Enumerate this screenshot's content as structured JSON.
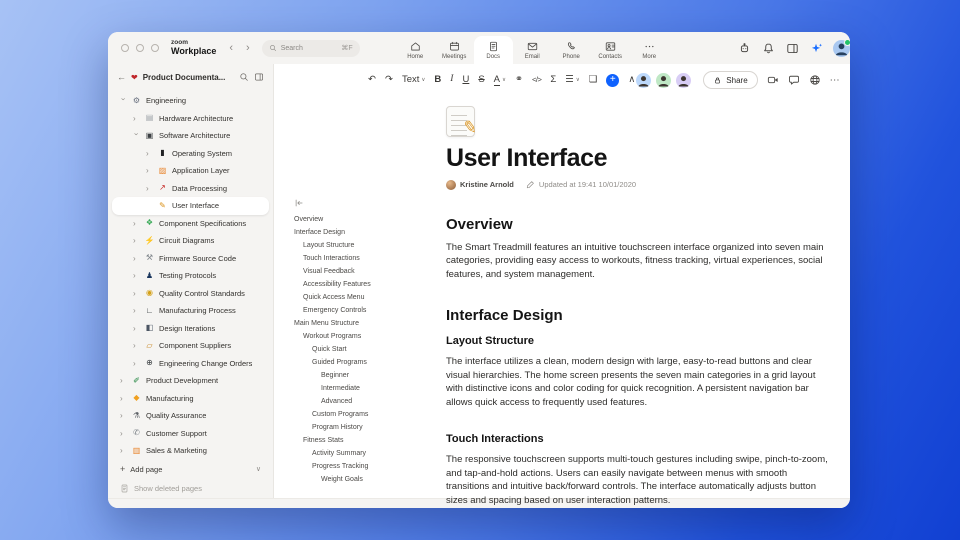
{
  "chrome": {
    "logo": {
      "top": "zoom",
      "bottom": "Workplace"
    },
    "nav": {
      "back": "‹",
      "forward": "›"
    },
    "search": {
      "placeholder": "Search",
      "shortcut": "⌘F"
    },
    "tabs": [
      {
        "id": "home",
        "label": "Home",
        "icon": "home-icon",
        "active": false
      },
      {
        "id": "meetings",
        "label": "Meetings",
        "icon": "meetings-icon",
        "active": false
      },
      {
        "id": "docs",
        "label": "Docs",
        "icon": "docs-icon",
        "active": true
      },
      {
        "id": "email",
        "label": "Email",
        "icon": "email-icon",
        "active": false
      },
      {
        "id": "phone",
        "label": "Phone",
        "icon": "phone-icon",
        "active": false
      },
      {
        "id": "contacts",
        "label": "Contacts",
        "icon": "contacts-icon",
        "active": false
      },
      {
        "id": "more",
        "label": "More",
        "icon": "more-icon",
        "active": false
      }
    ],
    "right_icons": [
      {
        "name": "assistant-icon"
      },
      {
        "name": "notifications-bell-icon"
      },
      {
        "name": "side-panel-icon"
      },
      {
        "name": "ai-companion-sparkle-icon"
      }
    ],
    "status_color": "#23c26b"
  },
  "sidebar": {
    "title": "Product Documenta...",
    "items": [
      {
        "label": "Engineering",
        "level": 0,
        "state": "expanded",
        "icon": "gear-emoji-icon",
        "glyph": "⚙",
        "color": "#6b7280"
      },
      {
        "label": "Hardware Architecture",
        "level": 1,
        "state": "collapsed",
        "icon": "chip-emoji-icon",
        "glyph": "▤",
        "color": "#9aa0a6"
      },
      {
        "label": "Software Architecture",
        "level": 1,
        "state": "expanded",
        "icon": "computer-emoji-icon",
        "glyph": "▣",
        "color": "#3c4043"
      },
      {
        "label": "Operating System",
        "level": 2,
        "state": "collapsed",
        "icon": "mobile-phone-emoji-icon",
        "glyph": "▮",
        "color": "#202124"
      },
      {
        "label": "Application Layer",
        "level": 2,
        "state": "collapsed",
        "icon": "framed-picture-emoji-icon",
        "glyph": "▨",
        "color": "#e8842c"
      },
      {
        "label": "Data Processing",
        "level": 2,
        "state": "collapsed",
        "icon": "chart-increasing-emoji-icon",
        "glyph": "↗",
        "color": "#c5221f"
      },
      {
        "label": "User Interface",
        "level": 2,
        "state": "none",
        "selected": true,
        "icon": "memo-emoji-icon",
        "glyph": "✎",
        "color": "#d98f16"
      },
      {
        "label": "Component Specifications",
        "level": 1,
        "state": "collapsed",
        "icon": "puzzle-piece-emoji-icon",
        "glyph": "❖",
        "color": "#34a853"
      },
      {
        "label": "Circuit Diagrams",
        "level": 1,
        "state": "collapsed",
        "icon": "electric-plug-emoji-icon",
        "glyph": "⚡",
        "color": "#3c4043"
      },
      {
        "label": "Firmware Source Code",
        "level": 1,
        "state": "collapsed",
        "icon": "wrench-emoji-icon",
        "glyph": "⚒",
        "color": "#80868b"
      },
      {
        "label": "Testing Protocols",
        "level": 1,
        "state": "collapsed",
        "icon": "officer-emoji-icon",
        "glyph": "♟",
        "color": "#1a365d"
      },
      {
        "label": "Quality Control Standards",
        "level": 1,
        "state": "collapsed",
        "icon": "traffic-light-emoji-icon",
        "glyph": "◉",
        "color": "#d4a017"
      },
      {
        "label": "Manufacturing Process",
        "level": 1,
        "state": "collapsed",
        "icon": "mechanical-arm-emoji-icon",
        "glyph": "∟",
        "color": "#3c4043"
      },
      {
        "label": "Design Iterations",
        "level": 1,
        "state": "collapsed",
        "icon": "camera-emoji-icon",
        "glyph": "◧",
        "color": "#4b5563"
      },
      {
        "label": "Component Suppliers",
        "level": 1,
        "state": "collapsed",
        "icon": "delivery-truck-emoji-icon",
        "glyph": "▱",
        "color": "#c47f17"
      },
      {
        "label": "Engineering Change Orders",
        "level": 1,
        "state": "collapsed",
        "icon": "globe-emoji-icon",
        "glyph": "⊕",
        "color": "#3c4043"
      },
      {
        "label": "Product Development",
        "level": 0,
        "state": "collapsed",
        "icon": "pen-emoji-icon",
        "glyph": "✐",
        "color": "#188038"
      },
      {
        "label": "Manufacturing",
        "level": 0,
        "state": "collapsed",
        "icon": "construction-worker-emoji-icon",
        "glyph": "◆",
        "color": "#f0a020"
      },
      {
        "label": "Quality Assurance",
        "level": 0,
        "state": "collapsed",
        "icon": "microscope-emoji-icon",
        "glyph": "⚗",
        "color": "#5f6368"
      },
      {
        "label": "Customer Support",
        "level": 0,
        "state": "collapsed",
        "icon": "speech-bubble-emoji-icon",
        "glyph": "✆",
        "color": "#80868b"
      },
      {
        "label": "Sales & Marketing",
        "level": 0,
        "state": "collapsed",
        "icon": "bar-chart-emoji-icon",
        "glyph": "▥",
        "color": "#e8842c"
      }
    ],
    "add_page_label": "Add page",
    "show_deleted_label": "Show deleted pages"
  },
  "outline": {
    "items": [
      {
        "label": "Overview",
        "level": 1
      },
      {
        "label": "Interface Design",
        "level": 1
      },
      {
        "label": "Layout Structure",
        "level": 2
      },
      {
        "label": "Touch Interactions",
        "level": 2
      },
      {
        "label": "Visual Feedback",
        "level": 2
      },
      {
        "label": "Accessibility Features",
        "level": 2
      },
      {
        "label": "Quick Access Menu",
        "level": 2
      },
      {
        "label": "Emergency Controls",
        "level": 2
      },
      {
        "label": "Main Menu Structure",
        "level": 1
      },
      {
        "label": "Workout Programs",
        "level": 2
      },
      {
        "label": "Quick Start",
        "level": 3
      },
      {
        "label": "Guided Programs",
        "level": 3
      },
      {
        "label": "Beginner",
        "level": 4
      },
      {
        "label": "Intermediate",
        "level": 4
      },
      {
        "label": "Advanced",
        "level": 4
      },
      {
        "label": "Custom Programs",
        "level": 3
      },
      {
        "label": "Program History",
        "level": 3
      },
      {
        "label": "Fitness Stats",
        "level": 2
      },
      {
        "label": "Activity Summary",
        "level": 3
      },
      {
        "label": "Progress Tracking",
        "level": 3
      },
      {
        "label": "Weight Goals",
        "level": 4
      }
    ]
  },
  "toolbar": {
    "buttons": [
      {
        "name": "undo-icon",
        "glyph": "↶"
      },
      {
        "name": "redo-icon",
        "glyph": "↷"
      },
      {
        "name": "text-style-select",
        "glyph": "Text",
        "caret": true
      },
      {
        "name": "bold-icon",
        "glyph": "B"
      },
      {
        "name": "italic-icon",
        "glyph": "I"
      },
      {
        "name": "underline-icon",
        "glyph": "U"
      },
      {
        "name": "strikethrough-icon",
        "glyph": "S"
      },
      {
        "name": "text-color-icon",
        "glyph": "A",
        "caret": true
      },
      {
        "name": "link-icon",
        "glyph": "⚭"
      },
      {
        "name": "code-icon",
        "glyph": "</>"
      },
      {
        "name": "formula-icon",
        "glyph": "Σ"
      },
      {
        "name": "align-icon",
        "glyph": "☰",
        "caret": true
      },
      {
        "name": "comment-icon",
        "glyph": "❏"
      },
      {
        "name": "insert-plus-icon",
        "glyph": "+",
        "accent": true
      },
      {
        "name": "collapse-toolbar-icon",
        "glyph": "∧"
      }
    ],
    "collaborator_colors": [
      "#bcd8fb",
      "#bfe8c5",
      "#d8cdf5"
    ],
    "share_label": "Share",
    "accent_color": "#0f62fe"
  },
  "doc": {
    "title": "User Interface",
    "author": "Kristine Arnold",
    "updated": "Updated at 19:41 10/01/2020",
    "sections": [
      {
        "type": "h2",
        "text": "Overview"
      },
      {
        "type": "p",
        "text": "The Smart Treadmill features an intuitive touchscreen interface organized into seven main categories, providing easy access to workouts, fitness tracking, virtual experiences, social features, and system management."
      },
      {
        "type": "h2",
        "text": "Interface Design"
      },
      {
        "type": "h3",
        "text": "Layout Structure"
      },
      {
        "type": "p",
        "text": "The interface utilizes a clean, modern design with large, easy-to-read buttons and clear visual hierarchies. The home screen presents the seven main categories in a grid layout with distinctive icons and color coding for quick recognition. A persistent navigation bar allows quick access to frequently used features."
      },
      {
        "type": "h3",
        "text": "Touch Interactions"
      },
      {
        "type": "p",
        "text": "The responsive touchscreen supports multi-touch gestures including swipe, pinch-to-zoom, and tap-and-hold actions. Users can easily navigate between menus with smooth transitions and intuitive back/forward controls. The interface automatically adjusts button sizes and spacing based on user interaction patterns."
      }
    ]
  }
}
